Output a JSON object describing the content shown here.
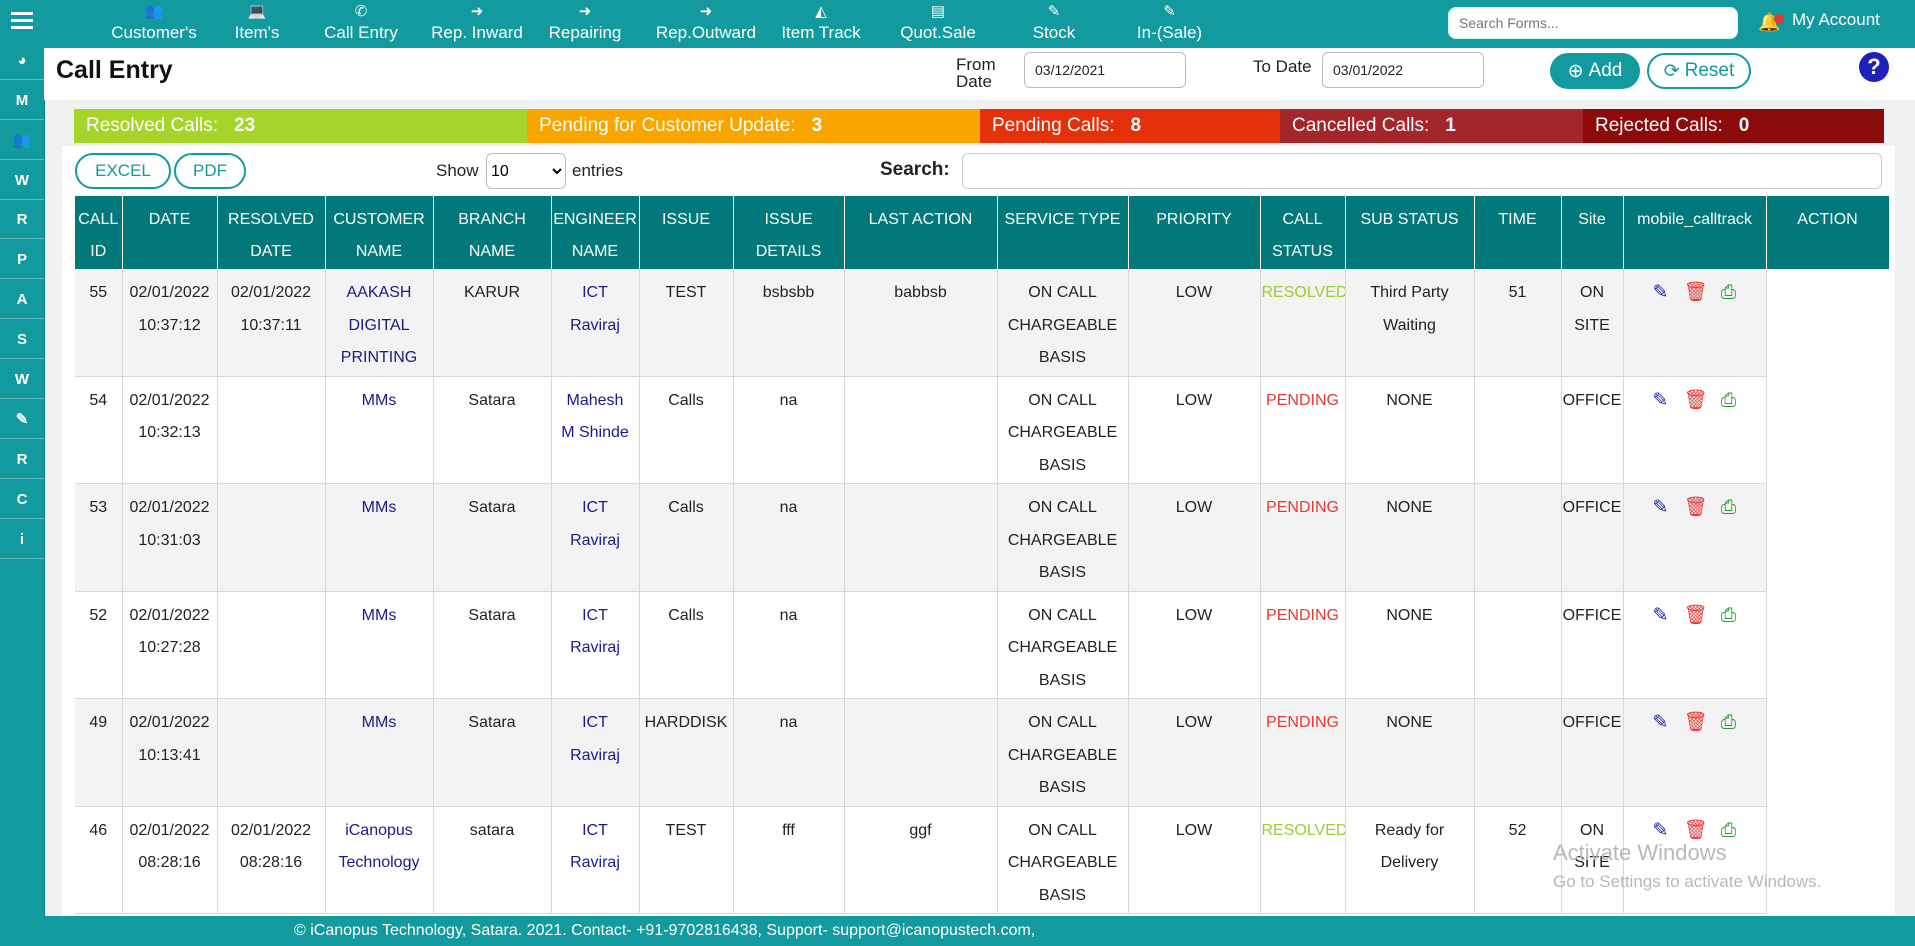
{
  "nav": {
    "items": [
      {
        "label": "Customer's",
        "icon": "users-icon",
        "glyph": "👥"
      },
      {
        "label": "Item's",
        "icon": "laptop-icon",
        "glyph": "💻"
      },
      {
        "label": "Call Entry",
        "icon": "phone-icon",
        "glyph": "✆"
      },
      {
        "label": "Rep. Inward",
        "icon": "sign-in-icon",
        "glyph": "➜"
      },
      {
        "label": "Repairing",
        "icon": "sign-in-icon",
        "glyph": "➜"
      },
      {
        "label": "Rep.Outward",
        "icon": "sign-in-icon",
        "glyph": "➜"
      },
      {
        "label": "Item Track",
        "icon": "chart-icon",
        "glyph": "◭"
      },
      {
        "label": "Quot.Sale",
        "icon": "file-icon",
        "glyph": "▤"
      },
      {
        "label": "Stock",
        "icon": "edit-icon",
        "glyph": "✎"
      },
      {
        "label": "In-(Sale)",
        "icon": "edit-icon",
        "glyph": "✎"
      }
    ],
    "search_placeholder": "Search Forms...",
    "account_label": "My Account"
  },
  "sidebar": {
    "items": [
      {
        "icon": "pie-chart-icon",
        "glyph": "◕"
      },
      {
        "icon": "m-icon",
        "glyph": "M"
      },
      {
        "icon": "users-icon",
        "glyph": "👥"
      },
      {
        "icon": "wordpress-icon",
        "glyph": "W"
      },
      {
        "icon": "r-icon",
        "glyph": "R"
      },
      {
        "icon": "p-icon",
        "glyph": "P"
      },
      {
        "icon": "a-icon",
        "glyph": "A"
      },
      {
        "icon": "s-icon",
        "glyph": "S"
      },
      {
        "icon": "wordpress-icon",
        "glyph": "W"
      },
      {
        "icon": "edit-icon",
        "glyph": "✎"
      },
      {
        "icon": "r-icon",
        "glyph": "R"
      },
      {
        "icon": "c-icon",
        "glyph": "C"
      },
      {
        "icon": "info-icon",
        "glyph": "i"
      }
    ]
  },
  "header": {
    "title": "Call Entry",
    "from_label_1": "From",
    "from_label_2": "Date",
    "from_date": "03/12/2021",
    "to_label": "To Date",
    "to_date": "03/01/2022",
    "add_label": "Add",
    "reset_label": "Reset",
    "help_glyph": "?"
  },
  "status": [
    {
      "label": "Resolved Calls:",
      "count": "23",
      "color": "#a6d42a"
    },
    {
      "label": "Pending for Customer Update:",
      "count": "3",
      "color": "#f9a500"
    },
    {
      "label": "Pending Calls:",
      "count": "8",
      "color": "#e4300b"
    },
    {
      "label": "Cancelled Calls:",
      "count": "1",
      "color": "#a3262a"
    },
    {
      "label": "Rejected Calls:",
      "count": "0",
      "color": "#8c0a0a"
    }
  ],
  "controls": {
    "excel_label": "EXCEL",
    "pdf_label": "PDF",
    "show_label": "Show",
    "show_value": "10",
    "entries_label": "entries",
    "search_label": "Search:"
  },
  "table": {
    "headers": [
      [
        "CALL",
        "ID"
      ],
      [
        "DATE"
      ],
      [
        "RESOLVED",
        "DATE"
      ],
      [
        "CUSTOMER",
        "NAME"
      ],
      [
        "BRANCH",
        "NAME"
      ],
      [
        "ENGINEER",
        "NAME"
      ],
      [
        "ISSUE"
      ],
      [
        "ISSUE",
        "DETAILS"
      ],
      [
        "LAST ACTION"
      ],
      [
        "SERVICE TYPE"
      ],
      [
        "PRIORITY"
      ],
      [
        "CALL",
        "STATUS"
      ],
      [
        "SUB STATUS"
      ],
      [
        "TIME"
      ],
      [
        "Site"
      ],
      [
        "mobile_calltrack"
      ],
      [
        "ACTION"
      ]
    ],
    "rows": [
      {
        "id": "55",
        "date": [
          "02/01/2022",
          "10:37:12"
        ],
        "resolved": [
          "02/01/2022",
          "10:37:11"
        ],
        "customer": [
          "AAKASH",
          "DIGITAL",
          "PRINTING"
        ],
        "branch": "KARUR",
        "engineer": [
          "ICT",
          "Raviraj"
        ],
        "issue": "TEST",
        "details": "bsbsbb",
        "last_action": "babbsb",
        "service": [
          "ON CALL",
          "CHARGEABLE",
          "BASIS"
        ],
        "priority": "LOW",
        "status": "RESOLVED",
        "sub_status": [
          "Third Party",
          "Waiting"
        ],
        "time": "51",
        "site": [
          "ON",
          "SITE"
        ]
      },
      {
        "id": "54",
        "date": [
          "02/01/2022",
          "10:32:13"
        ],
        "resolved": [],
        "customer": [
          "MMs"
        ],
        "branch": "Satara",
        "engineer": [
          "Mahesh",
          "M Shinde"
        ],
        "issue": "Calls",
        "details": "na",
        "last_action": "",
        "service": [
          "ON CALL",
          "CHARGEABLE",
          "BASIS"
        ],
        "priority": "LOW",
        "status": "PENDING",
        "sub_status": [
          "NONE"
        ],
        "time": "",
        "site": [
          "OFFICE"
        ]
      },
      {
        "id": "53",
        "date": [
          "02/01/2022",
          "10:31:03"
        ],
        "resolved": [],
        "customer": [
          "MMs"
        ],
        "branch": "Satara",
        "engineer": [
          "ICT",
          "Raviraj"
        ],
        "issue": "Calls",
        "details": "na",
        "last_action": "",
        "service": [
          "ON CALL",
          "CHARGEABLE",
          "BASIS"
        ],
        "priority": "LOW",
        "status": "PENDING",
        "sub_status": [
          "NONE"
        ],
        "time": "",
        "site": [
          "OFFICE"
        ]
      },
      {
        "id": "52",
        "date": [
          "02/01/2022",
          "10:27:28"
        ],
        "resolved": [],
        "customer": [
          "MMs"
        ],
        "branch": "Satara",
        "engineer": [
          "ICT",
          "Raviraj"
        ],
        "issue": "Calls",
        "details": "na",
        "last_action": "",
        "service": [
          "ON CALL",
          "CHARGEABLE",
          "BASIS"
        ],
        "priority": "LOW",
        "status": "PENDING",
        "sub_status": [
          "NONE"
        ],
        "time": "",
        "site": [
          "OFFICE"
        ]
      },
      {
        "id": "49",
        "date": [
          "02/01/2022",
          "10:13:41"
        ],
        "resolved": [],
        "customer": [
          "MMs"
        ],
        "branch": "Satara",
        "engineer": [
          "ICT",
          "Raviraj"
        ],
        "issue": "HARDDISK",
        "details": "na",
        "last_action": "",
        "service": [
          "ON CALL",
          "CHARGEABLE",
          "BASIS"
        ],
        "priority": "LOW",
        "status": "PENDING",
        "sub_status": [
          "NONE"
        ],
        "time": "",
        "site": [
          "OFFICE"
        ]
      },
      {
        "id": "46",
        "date": [
          "02/01/2022",
          "08:28:16"
        ],
        "resolved": [
          "02/01/2022",
          "08:28:16"
        ],
        "customer": [
          "iCanopus",
          "Technology"
        ],
        "branch": "satara",
        "engineer": [
          "ICT",
          "Raviraj"
        ],
        "issue": "TEST",
        "details": "fff",
        "last_action": "ggf",
        "service": [
          "ON CALL",
          "CHARGEABLE",
          "BASIS"
        ],
        "priority": "LOW",
        "status": "RESOLVED",
        "sub_status": [
          "Ready for",
          "Delivery"
        ],
        "time": "52",
        "site": [
          "ON",
          "SITE"
        ]
      }
    ]
  },
  "watermark": {
    "line1": "Activate Windows",
    "line2": "Go to Settings to activate Windows."
  },
  "footer": {
    "text": "© iCanopus Technology, Satara. 2021. Contact- +91-9702816438, Support- support@icanopustech.com,"
  }
}
